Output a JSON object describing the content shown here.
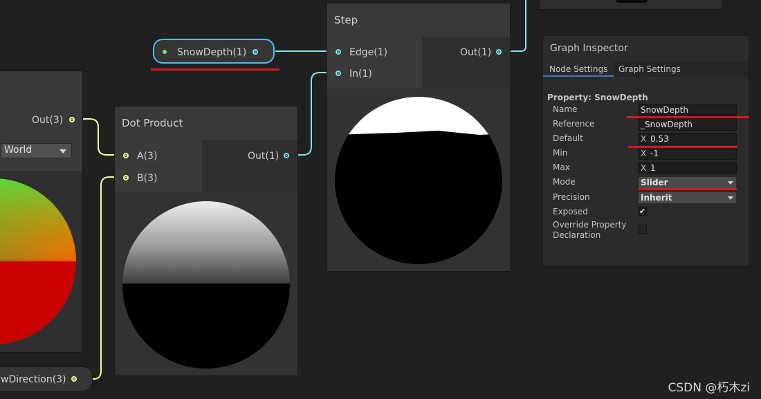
{
  "colors": {
    "canvas": "#202020",
    "wire_float": "#84e4e7",
    "wire_vector3": "#f6ff9a",
    "selection": "#44c0ef",
    "annotation_red": "#d2191e",
    "tab_underline": "#3a79bb"
  },
  "left_node": {
    "output_port": "Out(3)",
    "space_dropdown": "World"
  },
  "snowdepth_pill": {
    "label": "SnowDepth(1)"
  },
  "snowdirection_pill": {
    "label": "wDirection(3)"
  },
  "dot_product": {
    "title": "Dot Product",
    "inputs": [
      "A(3)",
      "B(3)"
    ],
    "output": "Out(1)"
  },
  "step": {
    "title": "Step",
    "inputs": [
      "Edge(1)",
      "In(1)"
    ],
    "output": "Out(1)"
  },
  "inspector": {
    "title": "Graph Inspector",
    "tabs": [
      "Node Settings",
      "Graph Settings"
    ],
    "property_header": "Property: SnowDepth",
    "name_label": "Name",
    "name_value": "SnowDepth",
    "reference_label": "Reference",
    "reference_value": "_SnowDepth",
    "default_label": "Default",
    "default_axis": "X",
    "default_value": "0.53",
    "min_label": "Min",
    "min_axis": "X",
    "min_value": "-1",
    "max_label": "Max",
    "max_axis": "X",
    "max_value": "1",
    "mode_label": "Mode",
    "mode_value": "Slider",
    "precision_label": "Precision",
    "precision_value": "Inherit",
    "exposed_label": "Exposed",
    "exposed_checked": true,
    "exposed_mark": "✔",
    "override_label_1": "Override Property",
    "override_label_2": "Declaration",
    "override_checked": false
  },
  "watermark": "CSDN @朽木zi"
}
